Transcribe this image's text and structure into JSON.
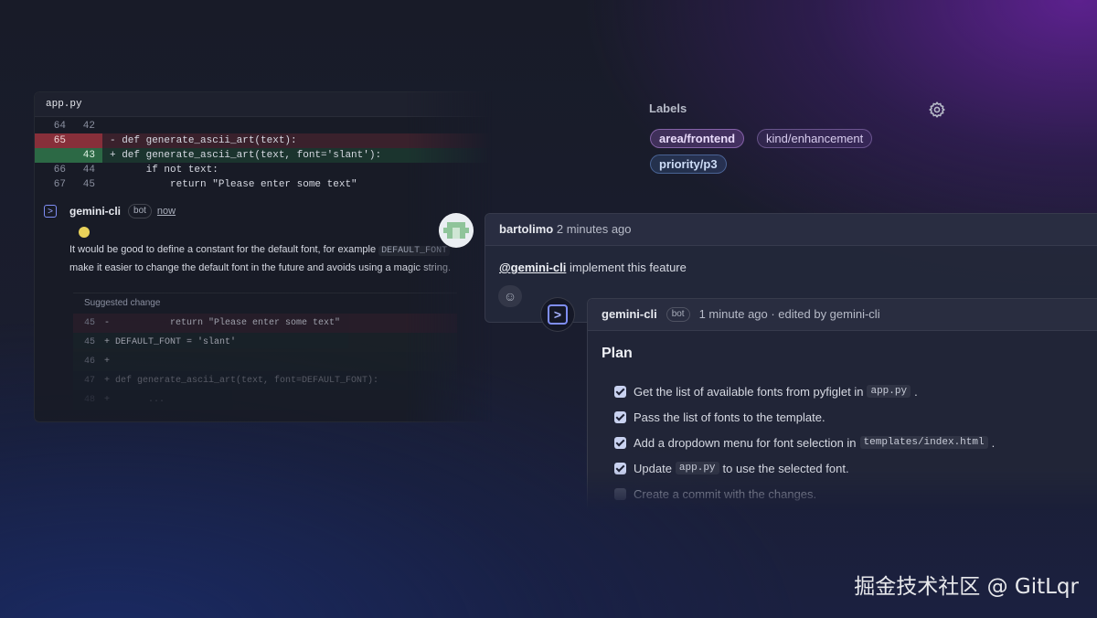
{
  "code_review": {
    "filename": "app.py",
    "diff": [
      {
        "type": "ctx",
        "old": "64",
        "new": "42",
        "code": ""
      },
      {
        "type": "del",
        "old": "65",
        "new": "",
        "code": "- def generate_ascii_art(text):"
      },
      {
        "type": "add",
        "old": "",
        "new": "43",
        "code": "+ def generate_ascii_art(text, font='slant'):"
      },
      {
        "type": "ctx",
        "old": "66",
        "new": "44",
        "code": "      if not text:"
      },
      {
        "type": "ctx",
        "old": "67",
        "new": "45",
        "code": "          return \"Please enter some text\""
      }
    ],
    "comment": {
      "author": "gemini-cli",
      "badge": "bot",
      "time": "now",
      "line1_pre": "It would be good to define a constant for the default font, for example ",
      "line1_code": "DEFAULT_FONT",
      "line2": "make it easier to change the default font in the future and avoids using a magic string."
    },
    "suggested": {
      "title": "Suggested change",
      "rows": [
        {
          "type": "del",
          "ln": "45",
          "code": "-           return \"Please enter some text\""
        },
        {
          "type": "add",
          "ln": "45",
          "code": "+ DEFAULT_FONT = 'slant'"
        },
        {
          "type": "add",
          "ln": "46",
          "code": "+"
        },
        {
          "type": "add",
          "ln": "47",
          "code": "+ def generate_ascii_art(text, font=DEFAULT_FONT):"
        },
        {
          "type": "add",
          "ln": "48",
          "code": "+       ..."
        }
      ]
    }
  },
  "labels": {
    "title": "Labels",
    "items": [
      "area/frontend",
      "kind/enhancement",
      "priority/p3"
    ]
  },
  "bartolimo_comment": {
    "author": "bartolimo",
    "time": "2 minutes ago",
    "mention": "@gemini-cli",
    "text": " implement this feature"
  },
  "plan_comment": {
    "author": "gemini-cli",
    "badge": "bot",
    "meta": "1 minute ago · edited by gemini-cli",
    "title": "Plan",
    "items": [
      {
        "checked": true,
        "pre": "Get the list of available fonts from pyfiglet in",
        "code": "app.py",
        "post": "."
      },
      {
        "checked": true,
        "pre": "Pass the list of fonts to the template.",
        "code": "",
        "post": ""
      },
      {
        "checked": true,
        "pre": "Add a dropdown menu for font selection in",
        "code": "templates/index.html",
        "post": "."
      },
      {
        "checked": true,
        "pre": "Update",
        "code": "app.py",
        "post": "to use the selected font."
      },
      {
        "checked": false,
        "pre": "Create a commit with the changes.",
        "code": "",
        "post": ""
      }
    ]
  },
  "watermark": "掘金技术社区 @ GitLqr",
  "colors": {
    "accent": "#7f8ef5",
    "diff_del": "#c83c46",
    "diff_add": "#3c965a"
  }
}
